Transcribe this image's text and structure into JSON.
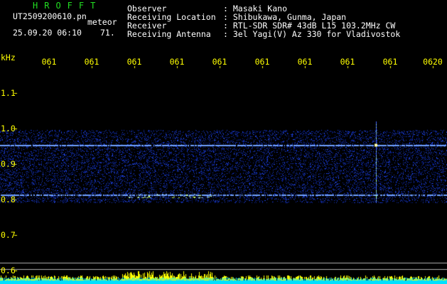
{
  "header": {
    "logo_text": "HROFFT",
    "filename": "UT2509200610.pn",
    "meteor_label": "meteor",
    "date_time": "25.09.20 06:10",
    "count": "71.",
    "info_labels": {
      "observer": "Observer",
      "location": "Receiving Location",
      "receiver": "Receiver",
      "antenna": "Receiving Antenna"
    },
    "info_values": {
      "observer": ": Masaki Kano",
      "location": ": Shibukawa, Gunma, Japan",
      "receiver": ": RTL-SDR SDR# 43dB L15 103.2MHz CW",
      "antenna": ": 3el Yagi(V) Az 330 for Vladivostok"
    }
  },
  "spectrogram": {
    "y_unit": "kHz",
    "y_ticks": [
      "1.1",
      "1.0",
      "0.9",
      "0.8",
      "0.7",
      "0.6"
    ],
    "y_range": [
      0.6,
      1.1
    ],
    "time_ticks": [
      "061",
      "061",
      "061",
      "061",
      "061",
      "061",
      "061",
      "061",
      "061",
      "0620"
    ],
    "colors": {
      "background": "#000000",
      "noise": "#1a2aff",
      "line": "#6fa0ff",
      "meteor": "#ffff88",
      "baseline": "#00e0ff",
      "activity": "#ffff00",
      "frame": "#b0b0b0"
    }
  }
}
